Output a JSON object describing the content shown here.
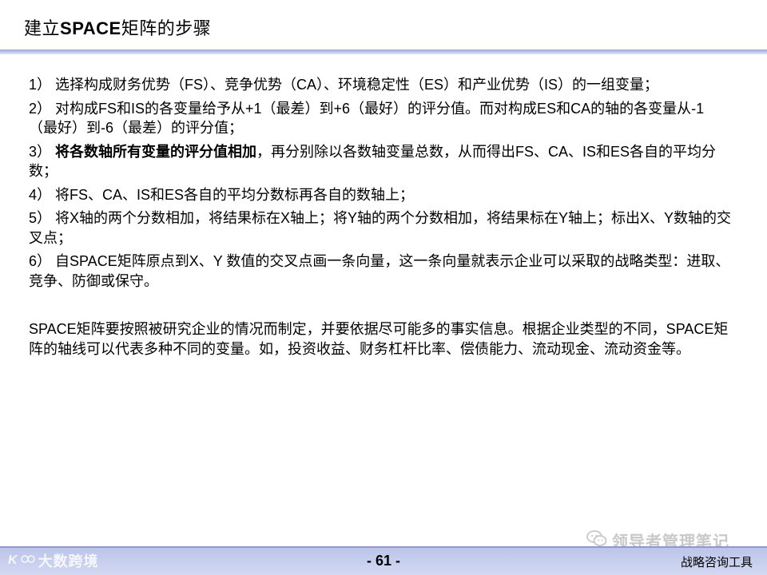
{
  "slide": {
    "title_prefix": "建立",
    "title_bold": "SPACE",
    "title_suffix": "矩阵的步骤"
  },
  "steps": [
    {
      "text": "1） 选择构成财务优势（FS）、竞争优势（CA）、环境稳定性（ES）和产业优势（IS）的一组变量；"
    },
    {
      "text": "2） 对构成FS和IS的各变量给予从+1（最差）到+6（最好）的评分值。而对构成ES和CA的轴的各变量从-1（最好）到-6（最差）的评分值；"
    },
    {
      "prefix": "3） ",
      "bold": "将各数轴所有变量的评分值相加",
      "suffix": "，再分别除以各数轴变量总数，从而得出FS、CA、IS和ES各自的平均分数；"
    },
    {
      "text": "4） 将FS、CA、IS和ES各自的平均分数标再各自的数轴上；"
    },
    {
      "text": "5） 将X轴的两个分数相加，将结果标在X轴上；将Y轴的两个分数相加，将结果标在Y轴上；标出X、Y数轴的交叉点；"
    },
    {
      "text": "6） 自SPACE矩阵原点到X、Y 数值的交叉点画一条向量，这一条向量就表示企业可以采取的战略类型：进取、竞争、防御或保守。"
    }
  ],
  "note": "SPACE矩阵要按照被研究企业的情况而制定，并要依据尽可能多的事实信息。根据企业类型的不同，SPACE矩阵的轴线可以代表多种不同的变量。如，投资收益、财务杠杆比率、偿债能力、流动现金、流动资金等。",
  "footer": {
    "page_number": "- 61 -",
    "right_label": "战略咨询工具",
    "brand_logo_text": "K",
    "brand_name": "大数跨境"
  },
  "watermark": {
    "name": "领导者管理笔记",
    "icon": "wechat-icon"
  }
}
